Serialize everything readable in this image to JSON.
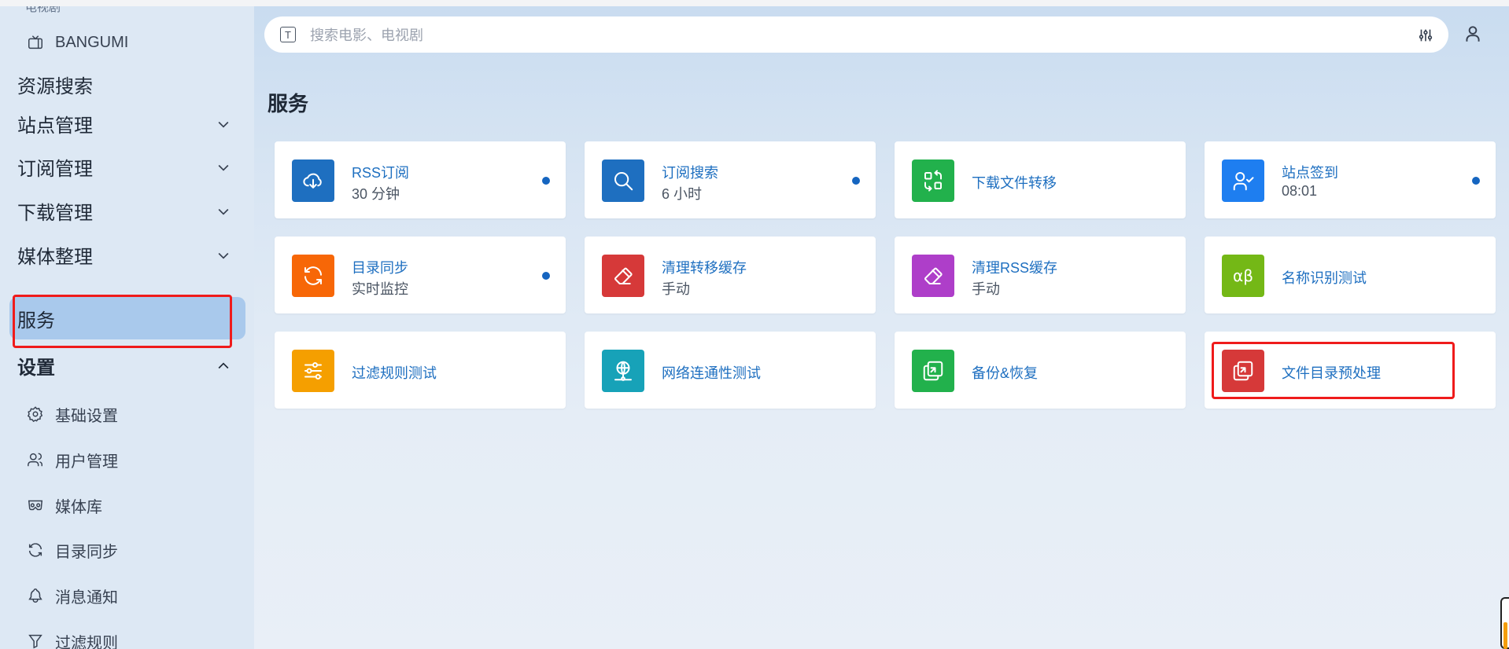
{
  "sidebar": {
    "cut_top": "电视剧",
    "bangumi": "BANGUMI",
    "resource_search": "资源搜索",
    "site_mgmt": "站点管理",
    "subscribe_mgmt": "订阅管理",
    "download_mgmt": "下载管理",
    "media_org": "媒体整理",
    "services": "服务",
    "settings": "设置",
    "settings_items": {
      "basic": "基础设置",
      "users": "用户管理",
      "library": "媒体库",
      "sync": "目录同步",
      "notify": "消息通知",
      "filter": "过滤规则"
    }
  },
  "search": {
    "placeholder": "搜索电影、电视剧",
    "prefix_icon": "T"
  },
  "main": {
    "title": "服务"
  },
  "cards": [
    {
      "title": "RSS订阅",
      "sub": "30 分钟",
      "color": "#1e6fc0",
      "icon": "cloud-download-icon",
      "dot": true
    },
    {
      "title": "订阅搜索",
      "sub": "6 小时",
      "color": "#1e6fc0",
      "icon": "search-icon",
      "dot": true
    },
    {
      "title": "下载文件转移",
      "sub": "",
      "color": "#22b14c",
      "icon": "transfer-icon",
      "dot": false
    },
    {
      "title": "站点签到",
      "sub": "08:01",
      "color": "#1e7ef0",
      "icon": "user-check-icon",
      "dot": true
    },
    {
      "title": "目录同步",
      "sub": "实时监控",
      "color": "#f76707",
      "icon": "refresh-icon",
      "dot": true
    },
    {
      "title": "清理转移缓存",
      "sub": "手动",
      "color": "#d63939",
      "icon": "eraser-icon",
      "dot": false
    },
    {
      "title": "清理RSS缓存",
      "sub": "手动",
      "color": "#ae3ec9",
      "icon": "eraser-icon",
      "dot": false
    },
    {
      "title": "名称识别测试",
      "sub": "",
      "color": "#74b816",
      "icon": "alpha-beta-icon",
      "dot": false
    },
    {
      "title": "过滤规则测试",
      "sub": "",
      "color": "#f59f00",
      "icon": "sliders-icon",
      "dot": false
    },
    {
      "title": "网络连通性测试",
      "sub": "",
      "color": "#17a2b8",
      "icon": "network-icon",
      "dot": false
    },
    {
      "title": "备份&恢复",
      "sub": "",
      "color": "#22b14c",
      "icon": "backup-icon",
      "dot": false
    },
    {
      "title": "文件目录预处理",
      "sub": "",
      "color": "#d63939",
      "icon": "backup-icon",
      "dot": false
    }
  ],
  "colors": {
    "accent": "#1e6fc0",
    "sidebar_bg": "#dde8f4",
    "active_bg": "#a9c9ec",
    "highlight": "#ef1b1b"
  }
}
